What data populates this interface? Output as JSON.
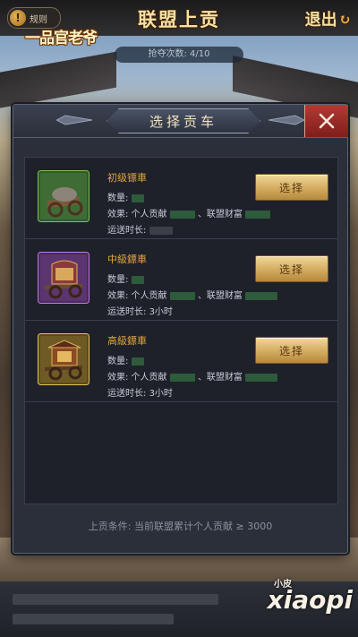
{
  "header": {
    "rules_label": "规则",
    "logo_text": "一品官老爷",
    "title": "联盟上贡",
    "exit_label": "退出",
    "rob_count": "抢夺次数: 4/10"
  },
  "modal": {
    "title": "选择贡车",
    "condition": "上贡条件: 当前联盟累计个人贡献 ≥ 3000",
    "select_label": "选择",
    "carts": [
      {
        "name": "初级镖車",
        "qty_label": "数量:",
        "effect_label": "效果: 个人贡献",
        "effect_sep": "、联盟财富",
        "time_label": "运送时长:",
        "time_value": ""
      },
      {
        "name": "中級鏢車",
        "qty_label": "数量:",
        "effect_label": "效果: 个人贡献",
        "effect_sep": "、联盟财富",
        "time_label": "运送时长:",
        "time_value": "3小时"
      },
      {
        "name": "高級鏢車",
        "qty_label": "数量:",
        "effect_label": "效果: 个人贡献",
        "effect_sep": "、联盟财富",
        "time_label": "运送时长:",
        "time_value": "3小时"
      }
    ]
  },
  "watermark": {
    "small": "小皮",
    "text": "xiaopi"
  },
  "colors": {
    "accent_gold": "#e3a640",
    "close_red": "#b33a34",
    "panel_bg": "#2b2f3a"
  }
}
